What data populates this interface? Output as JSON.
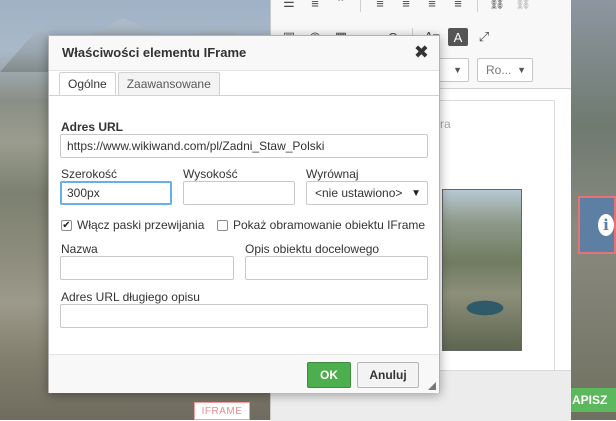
{
  "dialog": {
    "title": "Właściwości elementu IFrame",
    "close_glyph": "✖",
    "tabs": [
      {
        "label": "Ogólne",
        "active": true
      },
      {
        "label": "Zaawansowane",
        "active": false
      }
    ],
    "url_label": "Adres URL",
    "url_value": "https://www.wikiwand.com/pl/Zadni_Staw_Polski",
    "width_label": "Szerokość",
    "width_value": "300px",
    "height_label": "Wysokość",
    "height_value": "",
    "align_label": "Wyrównaj",
    "align_value": "<nie ustawiono>",
    "scrollbars_label": "Włącz paski przewijania",
    "scrollbars_checked": true,
    "border_label": "Pokaż obramowanie obiektu IFrame",
    "border_checked": false,
    "name_label": "Nazwa",
    "name_value": "",
    "title_field_label": "Opis obiektu docelowego",
    "title_field_value": "",
    "longdesc_label": "Adres URL długiego opisu",
    "longdesc_value": "",
    "ok_label": "OK",
    "cancel_label": "Anuluj"
  },
  "editor": {
    "toolbar_row1": [
      "numbered-list-icon",
      "bulleted-list-icon",
      "blockquote-icon",
      "align-left-icon",
      "align-center-icon",
      "align-right-icon",
      "align-justify-icon",
      "link-icon",
      "unlink-icon"
    ],
    "toolbar_row2": [
      "image-icon",
      "flash-icon",
      "table-icon",
      "horizontal-line-icon",
      "special-char-icon",
      "text-color-icon",
      "bg-color-icon",
      "maximize-icon"
    ],
    "format_select": "",
    "size_select": "Ro...",
    "content_ghost_text": "ra",
    "iframe_label": "IFRAME"
  },
  "page": {
    "napisz_label": "APISZ",
    "info_glyph": "i"
  }
}
